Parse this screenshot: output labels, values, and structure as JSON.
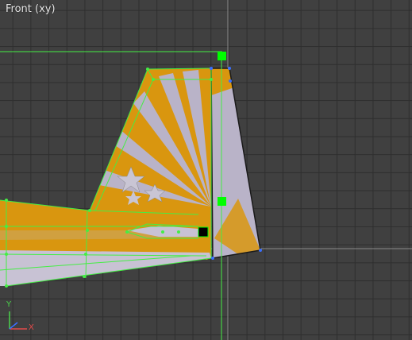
{
  "viewport": {
    "label": "Front (xy)"
  },
  "axis_gizmo": {
    "x_label": "X",
    "y_label": "Y",
    "x_color": "#e24a4a",
    "y_color": "#4ad24a"
  },
  "colors": {
    "background": "#404040",
    "grid": "#2e2e2e",
    "selection": "#44ee44",
    "wire_dark": "#1a1a1a",
    "texture_orange": "#d9960f",
    "texture_light": "#b9b3c8",
    "handle": "#00ff00"
  }
}
